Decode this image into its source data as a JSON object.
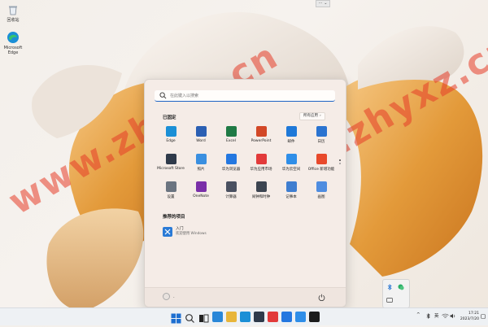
{
  "desktop": {
    "icons": [
      {
        "label": "回收站",
        "icon": "recycle-bin-icon"
      },
      {
        "label": "Microsoft Edge",
        "icon": "edge-icon"
      }
    ],
    "watermark": "www.zhyxz.cn"
  },
  "start_menu": {
    "search_placeholder": "在此键入以搜索",
    "pinned_title": "已固定",
    "all_apps_label": "所有应用",
    "all_apps_chevron": "›",
    "pinned_apps": [
      {
        "label": "Edge",
        "icon": "edge-icon",
        "color": "#1b8fd6"
      },
      {
        "label": "Word",
        "icon": "word-icon",
        "color": "#2b5fb3"
      },
      {
        "label": "Excel",
        "icon": "excel-icon",
        "color": "#1f7a45"
      },
      {
        "label": "PowerPoint",
        "icon": "powerpoint-icon",
        "color": "#d24726"
      },
      {
        "label": "邮件",
        "icon": "mail-icon",
        "color": "#1e78d8"
      },
      {
        "label": "日历",
        "icon": "calendar-icon",
        "color": "#2a73d0"
      },
      {
        "label": "Microsoft Store",
        "icon": "store-icon",
        "color": "#2f3a4a"
      },
      {
        "label": "照片",
        "icon": "photos-icon",
        "color": "#3a8fe0"
      },
      {
        "label": "华为浏览器",
        "icon": "huawei-browser-icon",
        "color": "#2477e0"
      },
      {
        "label": "华为应用市场",
        "icon": "huawei-appgallery-icon",
        "color": "#e23a3a"
      },
      {
        "label": "华为云空间",
        "icon": "huawei-cloud-icon",
        "color": "#2f8ee8"
      },
      {
        "label": "Office 新增功能",
        "icon": "office-icon",
        "color": "#e8492b"
      },
      {
        "label": "设置",
        "icon": "settings-icon",
        "color": "#6b7480"
      },
      {
        "label": "OneNote",
        "icon": "onenote-icon",
        "color": "#7a2fa8"
      },
      {
        "label": "计算器",
        "icon": "calculator-icon",
        "color": "#4a5060"
      },
      {
        "label": "闹钟和时钟",
        "icon": "clock-icon",
        "color": "#3c4450"
      },
      {
        "label": "记事本",
        "icon": "notepad-icon",
        "color": "#3f7ed0"
      },
      {
        "label": "画图",
        "icon": "paint-icon",
        "color": "#4f8de0"
      }
    ],
    "recommended_title": "推荐的项目",
    "recommended": [
      {
        "title": "入门",
        "subtitle": "欢迎使用 Windows",
        "icon": "get-started-icon"
      }
    ],
    "user_name": "․",
    "power_icon": "power-icon"
  },
  "taskbar": {
    "pinned": [
      {
        "icon": "start-icon",
        "color": "#1e6fd0",
        "active": false
      },
      {
        "icon": "search-icon",
        "color": "#333333",
        "active": false
      },
      {
        "icon": "task-view-icon",
        "color": "#333333",
        "active": false
      },
      {
        "icon": "widgets-icon",
        "color": "#2a87d8",
        "active": false
      },
      {
        "icon": "file-explorer-icon",
        "color": "#e8b53a",
        "active": false
      },
      {
        "icon": "edge-icon",
        "color": "#1b8fd6",
        "active": false
      },
      {
        "icon": "store-icon",
        "color": "#2f3a4a",
        "active": false
      },
      {
        "icon": "huawei-appgallery-icon",
        "color": "#e23a3a",
        "active": false
      },
      {
        "icon": "huawei-browser-icon",
        "color": "#2477e0",
        "active": false
      },
      {
        "icon": "huawei-cloud-icon",
        "color": "#2f8ee8",
        "active": false
      },
      {
        "icon": "app-icon",
        "color": "#1c1c1c",
        "active": false
      }
    ],
    "tray_chevron": "^",
    "ime_label": "英",
    "clock_time": "17:21",
    "clock_date": "2023/7/20"
  },
  "colors": {
    "accent": "#1d63c4"
  }
}
